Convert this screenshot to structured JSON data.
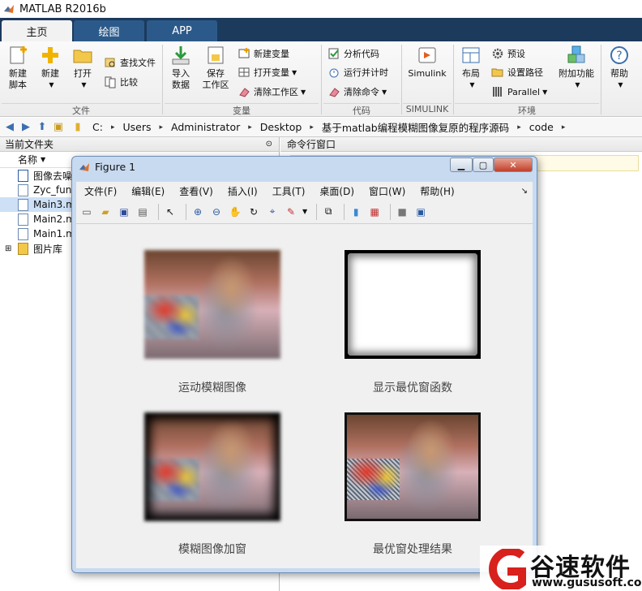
{
  "window": {
    "title": "MATLAB R2016b"
  },
  "tabs": [
    {
      "label": "主页"
    },
    {
      "label": "绘图"
    },
    {
      "label": "APP"
    }
  ],
  "ribbon": {
    "file": {
      "new_script": "新建\n脚本",
      "new": "新建",
      "open": "打开",
      "find_files": "查找文件",
      "compare": "比较",
      "group": "文件"
    },
    "variable": {
      "import": "导入\n数据",
      "save_ws": "保存\n工作区",
      "new_var": "新建变量",
      "open_var": "打开变量",
      "clear_ws": "清除工作区",
      "group": "变量"
    },
    "code": {
      "analyze": "分析代码",
      "run_time": "运行并计时",
      "clear_cmd": "清除命令",
      "group": "代码"
    },
    "simulink": {
      "label": "Simulink",
      "group": "SIMULINK"
    },
    "env": {
      "layout": "布局",
      "prefs": "预设",
      "set_path": "设置路径",
      "parallel": "Parallel",
      "addons": "附加功能",
      "group": "环境"
    },
    "help": {
      "label": "帮助"
    }
  },
  "address": {
    "crumbs": [
      "C:",
      "Users",
      "Administrator",
      "Desktop",
      "基于matlab编程模糊图像复原的程序源码",
      "code"
    ]
  },
  "current_folder": {
    "title": "当前文件夹",
    "col_name": "名称",
    "files": [
      {
        "name": "图像去噪"
      },
      {
        "name": "Zyc_fun."
      },
      {
        "name": "Main3.m"
      },
      {
        "name": "Main2.m"
      },
      {
        "name": "Main1.m"
      },
      {
        "name": "图片库"
      }
    ]
  },
  "command_window": {
    "title": "命令行窗口"
  },
  "figure": {
    "title": "Figure 1",
    "menu": [
      "文件(F)",
      "编辑(E)",
      "查看(V)",
      "插入(I)",
      "工具(T)",
      "桌面(D)",
      "窗口(W)",
      "帮助(H)"
    ],
    "captions": [
      "运动模糊图像",
      "显示最优窗函数",
      "模糊图像加窗",
      "最优窗处理结果"
    ]
  },
  "watermark": {
    "brand": "谷速软件",
    "url": "www.gususoft.com"
  },
  "colors": {
    "tab_bar": "#1b3a5c",
    "tab": "#2b5a8a",
    "watermark_red": "#d8201c"
  }
}
